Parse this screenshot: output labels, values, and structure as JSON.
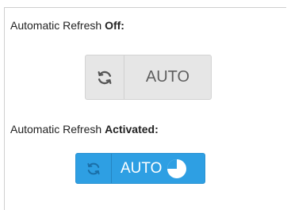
{
  "off_state": {
    "caption_prefix": "Automatic Refresh ",
    "caption_emphasis": "Off:",
    "button_label": "AUTO",
    "refresh_icon": "refresh-icon"
  },
  "on_state": {
    "caption_prefix": "Automatic Refresh ",
    "caption_emphasis": "Activated:",
    "button_label": "AUTO",
    "refresh_icon": "refresh-icon",
    "timer_icon": "countdown-timer-icon",
    "timer_progress": 0.75
  },
  "colors": {
    "off_background": "#e6e6e6",
    "off_text": "#5f5f5f",
    "on_background": "#2e9fe3",
    "on_text": "#ffffff"
  }
}
